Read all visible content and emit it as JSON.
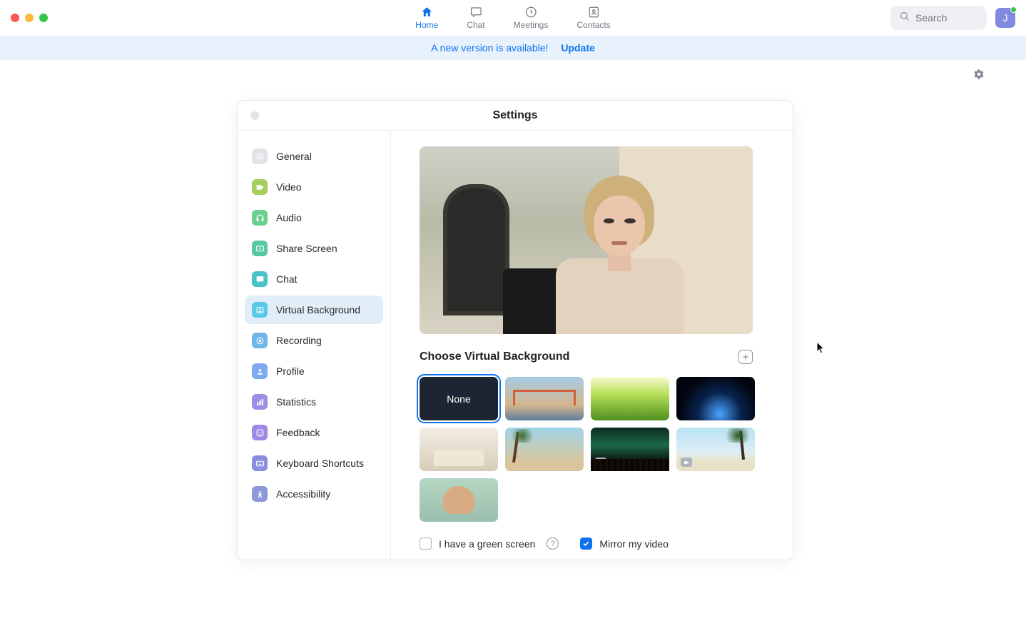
{
  "nav": {
    "tabs": [
      {
        "label": "Home",
        "icon": "home"
      },
      {
        "label": "Chat",
        "icon": "chat"
      },
      {
        "label": "Meetings",
        "icon": "clock"
      },
      {
        "label": "Contacts",
        "icon": "contacts"
      }
    ],
    "active_index": 0,
    "search_placeholder": "Search",
    "avatar_initial": "J"
  },
  "banner": {
    "message": "A new version is available!",
    "action": "Update"
  },
  "settings": {
    "title": "Settings",
    "sidebar": {
      "items": [
        {
          "label": "General"
        },
        {
          "label": "Video"
        },
        {
          "label": "Audio"
        },
        {
          "label": "Share Screen"
        },
        {
          "label": "Chat"
        },
        {
          "label": "Virtual Background"
        },
        {
          "label": "Recording"
        },
        {
          "label": "Profile"
        },
        {
          "label": "Statistics"
        },
        {
          "label": "Feedback"
        },
        {
          "label": "Keyboard Shortcuts"
        },
        {
          "label": "Accessibility"
        }
      ],
      "active_index": 5
    },
    "panel": {
      "section_title": "Choose Virtual Background",
      "none_label": "None",
      "backgrounds": [
        {
          "kind": "none",
          "selected": true
        },
        {
          "kind": "bridge"
        },
        {
          "kind": "grass"
        },
        {
          "kind": "earth"
        },
        {
          "kind": "room"
        },
        {
          "kind": "palms"
        },
        {
          "kind": "aurora",
          "video": true
        },
        {
          "kind": "beach",
          "video": true
        },
        {
          "kind": "man"
        }
      ],
      "options": {
        "green_screen_label": "I have a green screen",
        "green_screen_checked": false,
        "mirror_label": "Mirror my video",
        "mirror_checked": true
      }
    }
  }
}
